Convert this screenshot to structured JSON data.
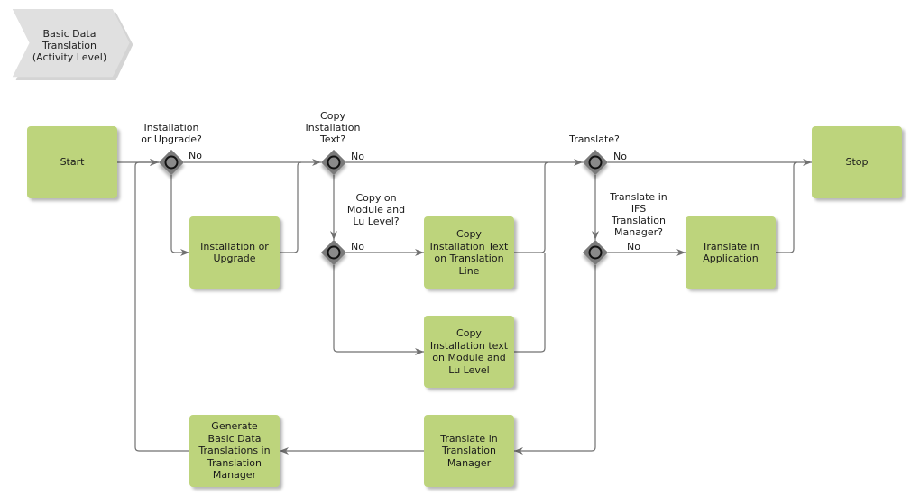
{
  "diagram": {
    "title": "Basic Data\nTranslation\n(Activity Level)",
    "colors": {
      "task_fill": "#bdd47c",
      "gateway_fill": "#7a7a7a",
      "connector": "#707070",
      "title_fill": "#e0e0e0"
    },
    "tasks": {
      "start": "Start",
      "installation_or_upgrade": "Installation or\nUpgrade",
      "copy_text_translation_line": "Copy\nInstallation Text\non Translation\nLine",
      "copy_text_module_lu": "Copy\nInstallation text\non Module and\nLu Level",
      "translate_in_application": "Translate in\nApplication",
      "stop": "Stop",
      "generate_basic_data": "Generate\nBasic Data\nTranslations in\nTranslation\nManager",
      "translate_in_translation_manager": "Translate in\nTranslation\nManager"
    },
    "gateways": {
      "installation_or_upgrade": "Installation\nor Upgrade?",
      "copy_installation_text": "Copy\nInstallation\nText?",
      "copy_module_lu": "Copy on\nModule and\nLu Level?",
      "translate": "Translate?",
      "translate_ifs_manager": "Translate in\nIFS\nTranslation\nManager?"
    },
    "flow_labels": {
      "no": "No"
    }
  }
}
